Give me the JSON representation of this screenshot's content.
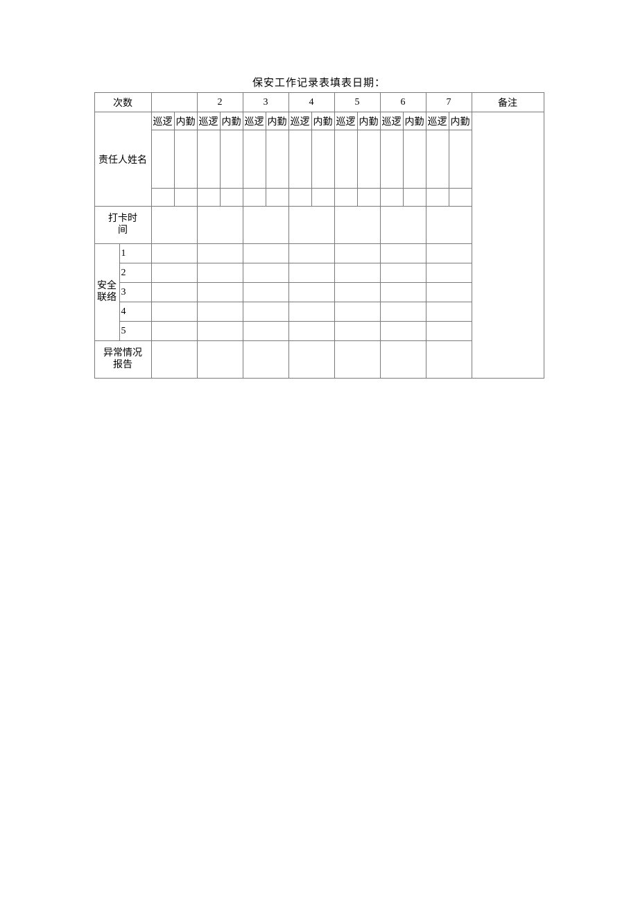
{
  "title": "保安工作记录表填表日期：",
  "headers": {
    "count": "次数",
    "nums": [
      "",
      "2",
      "3",
      "4",
      "5",
      "6",
      "7"
    ],
    "remarks": "备注"
  },
  "sub": {
    "a": "巡逻",
    "b": "内勤"
  },
  "rows": {
    "responsible": "责任人姓名",
    "clock": "打卡时间",
    "clock_l1": "打卡时",
    "clock_l2": "间",
    "safety": "安全联络",
    "safety_l1": "安全",
    "safety_l2": "联络",
    "safety_items": [
      "1",
      "2",
      "3",
      "4",
      "5"
    ],
    "abnormal": "异常情况报告",
    "abnormal_l1": "异常情况",
    "abnormal_l2": "报告"
  }
}
